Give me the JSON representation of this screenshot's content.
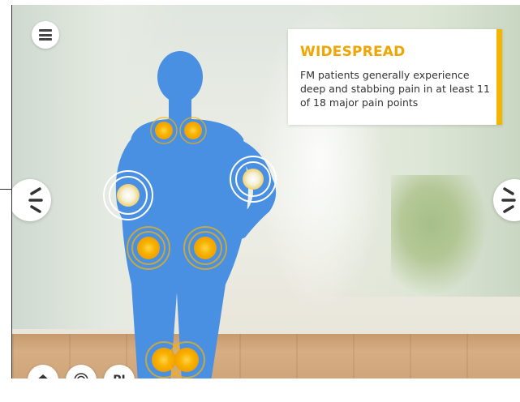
{
  "info_card": {
    "title": "WIDESPREAD",
    "text": "FM patients generally experience deep and stabbing pain in at least 11 of 18 major pain points"
  },
  "colors": {
    "accent": "#f5b400",
    "title": "#f0a500",
    "figure": "#4a90e2",
    "pain_point": "#f5a800"
  },
  "toolbar": {
    "menu_icon": "hamburger-menu-icon",
    "prev_icon": "chevron-left-icon",
    "next_icon": "chevron-right-icon",
    "home_icon": "home-icon",
    "target_icon": "target-icon",
    "pi_label": "PI"
  }
}
